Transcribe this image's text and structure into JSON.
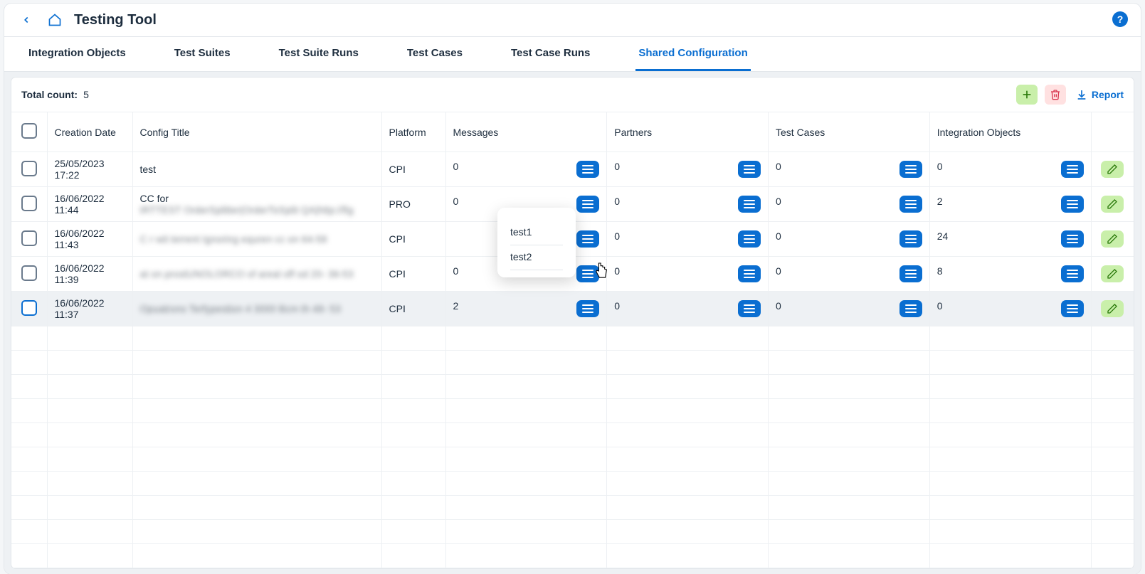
{
  "header": {
    "title": "Testing Tool"
  },
  "tabs": [
    {
      "label": "Integration Objects",
      "active": false
    },
    {
      "label": "Test Suites",
      "active": false
    },
    {
      "label": "Test Suite Runs",
      "active": false
    },
    {
      "label": "Test Cases",
      "active": false
    },
    {
      "label": "Test Case Runs",
      "active": false
    },
    {
      "label": "Shared Configuration",
      "active": true
    }
  ],
  "toolbar": {
    "total_label": "Total count:",
    "total_count": "5",
    "report_label": "Report"
  },
  "columns": {
    "creation_date": "Creation Date",
    "config_title": "Config Title",
    "platform": "Platform",
    "messages": "Messages",
    "partners": "Partners",
    "test_cases": "Test Cases",
    "integration_objects": "Integration Objects"
  },
  "rows": [
    {
      "date": "25/05/2023 17:22",
      "title": "test",
      "title_blur": false,
      "platform": "CPI",
      "messages": "0",
      "partners": "0",
      "test_cases": "0",
      "integration_objects": "0",
      "highlight": false
    },
    {
      "date": "16/06/2022 11:44",
      "title": "CC for",
      "title_blur": false,
      "title_blur_extra": "IRTTEST OrderSplitter|OrderToSplit QA|http://fig",
      "platform": "PRO",
      "messages": "0",
      "partners": "0",
      "test_cases": "0",
      "integration_objects": "2",
      "highlight": false
    },
    {
      "date": "16/06/2022 11:43",
      "title": "C r wit terrent Ignoring equren cc on 64-58",
      "title_blur": true,
      "platform": "CPI",
      "messages": "",
      "partners": "0",
      "test_cases": "0",
      "integration_objects": "24",
      "highlight": false
    },
    {
      "date": "16/06/2022 11:39",
      "title": "at on prostUNOLORCO of areal off od 20- 36-53",
      "title_blur": true,
      "platform": "CPI",
      "messages": "0",
      "partners": "0",
      "test_cases": "0",
      "integration_objects": "8",
      "highlight": false
    },
    {
      "date": "16/06/2022 11:37",
      "title": "Opuatrons Terfypestion 4 3000 Bcm th 48- 53",
      "title_blur": true,
      "platform": "CPI",
      "messages": "2",
      "partners": "0",
      "test_cases": "0",
      "integration_objects": "0",
      "highlight": true
    }
  ],
  "popover": {
    "items": [
      "test1",
      "test2"
    ]
  }
}
